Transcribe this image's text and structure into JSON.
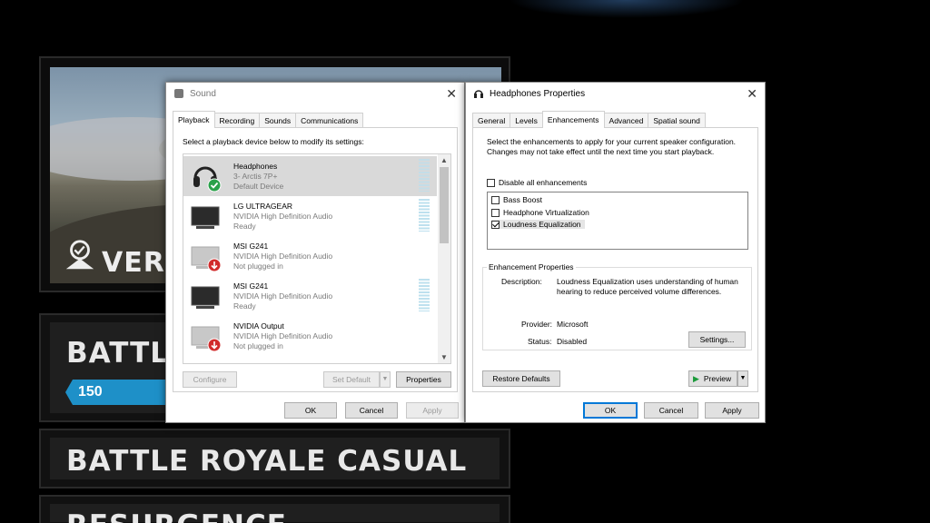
{
  "game": {
    "map_name": "VERDA",
    "modes": [
      {
        "label": "BATTLE R",
        "badge": "150 PLAYERS"
      },
      {
        "label": "BATTLE ROYALE CASUAL"
      },
      {
        "label": "RESURGENCE"
      }
    ]
  },
  "sound_dialog": {
    "title": "Sound",
    "tabs": [
      "Playback",
      "Recording",
      "Sounds",
      "Communications"
    ],
    "instruction": "Select a playback device below to modify its settings:",
    "devices": [
      {
        "name": "Headphones",
        "line2": "3- Arctis 7P+",
        "line3": "Default Device",
        "icon": "headphones-icon",
        "status": "default"
      },
      {
        "name": "LG ULTRAGEAR",
        "line2": "NVIDIA High Definition Audio",
        "line3": "Ready",
        "icon": "monitor-icon",
        "status": "ready"
      },
      {
        "name": "MSI G241",
        "line2": "NVIDIA High Definition Audio",
        "line3": "Not plugged in",
        "icon": "monitor-icon",
        "status": "unplugged"
      },
      {
        "name": "MSI G241",
        "line2": "NVIDIA High Definition Audio",
        "line3": "Ready",
        "icon": "monitor-icon",
        "status": "ready"
      },
      {
        "name": "NVIDIA Output",
        "line2": "NVIDIA High Definition Audio",
        "line3": "Not plugged in",
        "icon": "monitor-icon",
        "status": "unplugged"
      }
    ],
    "buttons": {
      "configure": "Configure",
      "set_default": "Set Default",
      "properties": "Properties",
      "ok": "OK",
      "cancel": "Cancel",
      "apply": "Apply"
    }
  },
  "props_dialog": {
    "title": "Headphones Properties",
    "tabs": [
      "General",
      "Levels",
      "Enhancements",
      "Advanced",
      "Spatial sound"
    ],
    "intro": "Select the enhancements to apply for your current speaker configuration. Changes may not take effect until the next time you start playback.",
    "disable_all": "Disable all enhancements",
    "enhancements": [
      {
        "label": "Bass Boost",
        "checked": false
      },
      {
        "label": "Headphone Virtualization",
        "checked": false
      },
      {
        "label": "Loudness Equalization",
        "checked": true
      }
    ],
    "group_title": "Enhancement Properties",
    "description_label": "Description:",
    "description": "Loudness Equalization uses understanding of human hearing to reduce perceived volume differences.",
    "provider_label": "Provider:",
    "provider": "Microsoft",
    "status_label": "Status:",
    "status": "Disabled",
    "buttons": {
      "settings": "Settings...",
      "restore": "Restore Defaults",
      "preview": "Preview",
      "ok": "OK",
      "cancel": "Cancel",
      "apply": "Apply"
    }
  }
}
